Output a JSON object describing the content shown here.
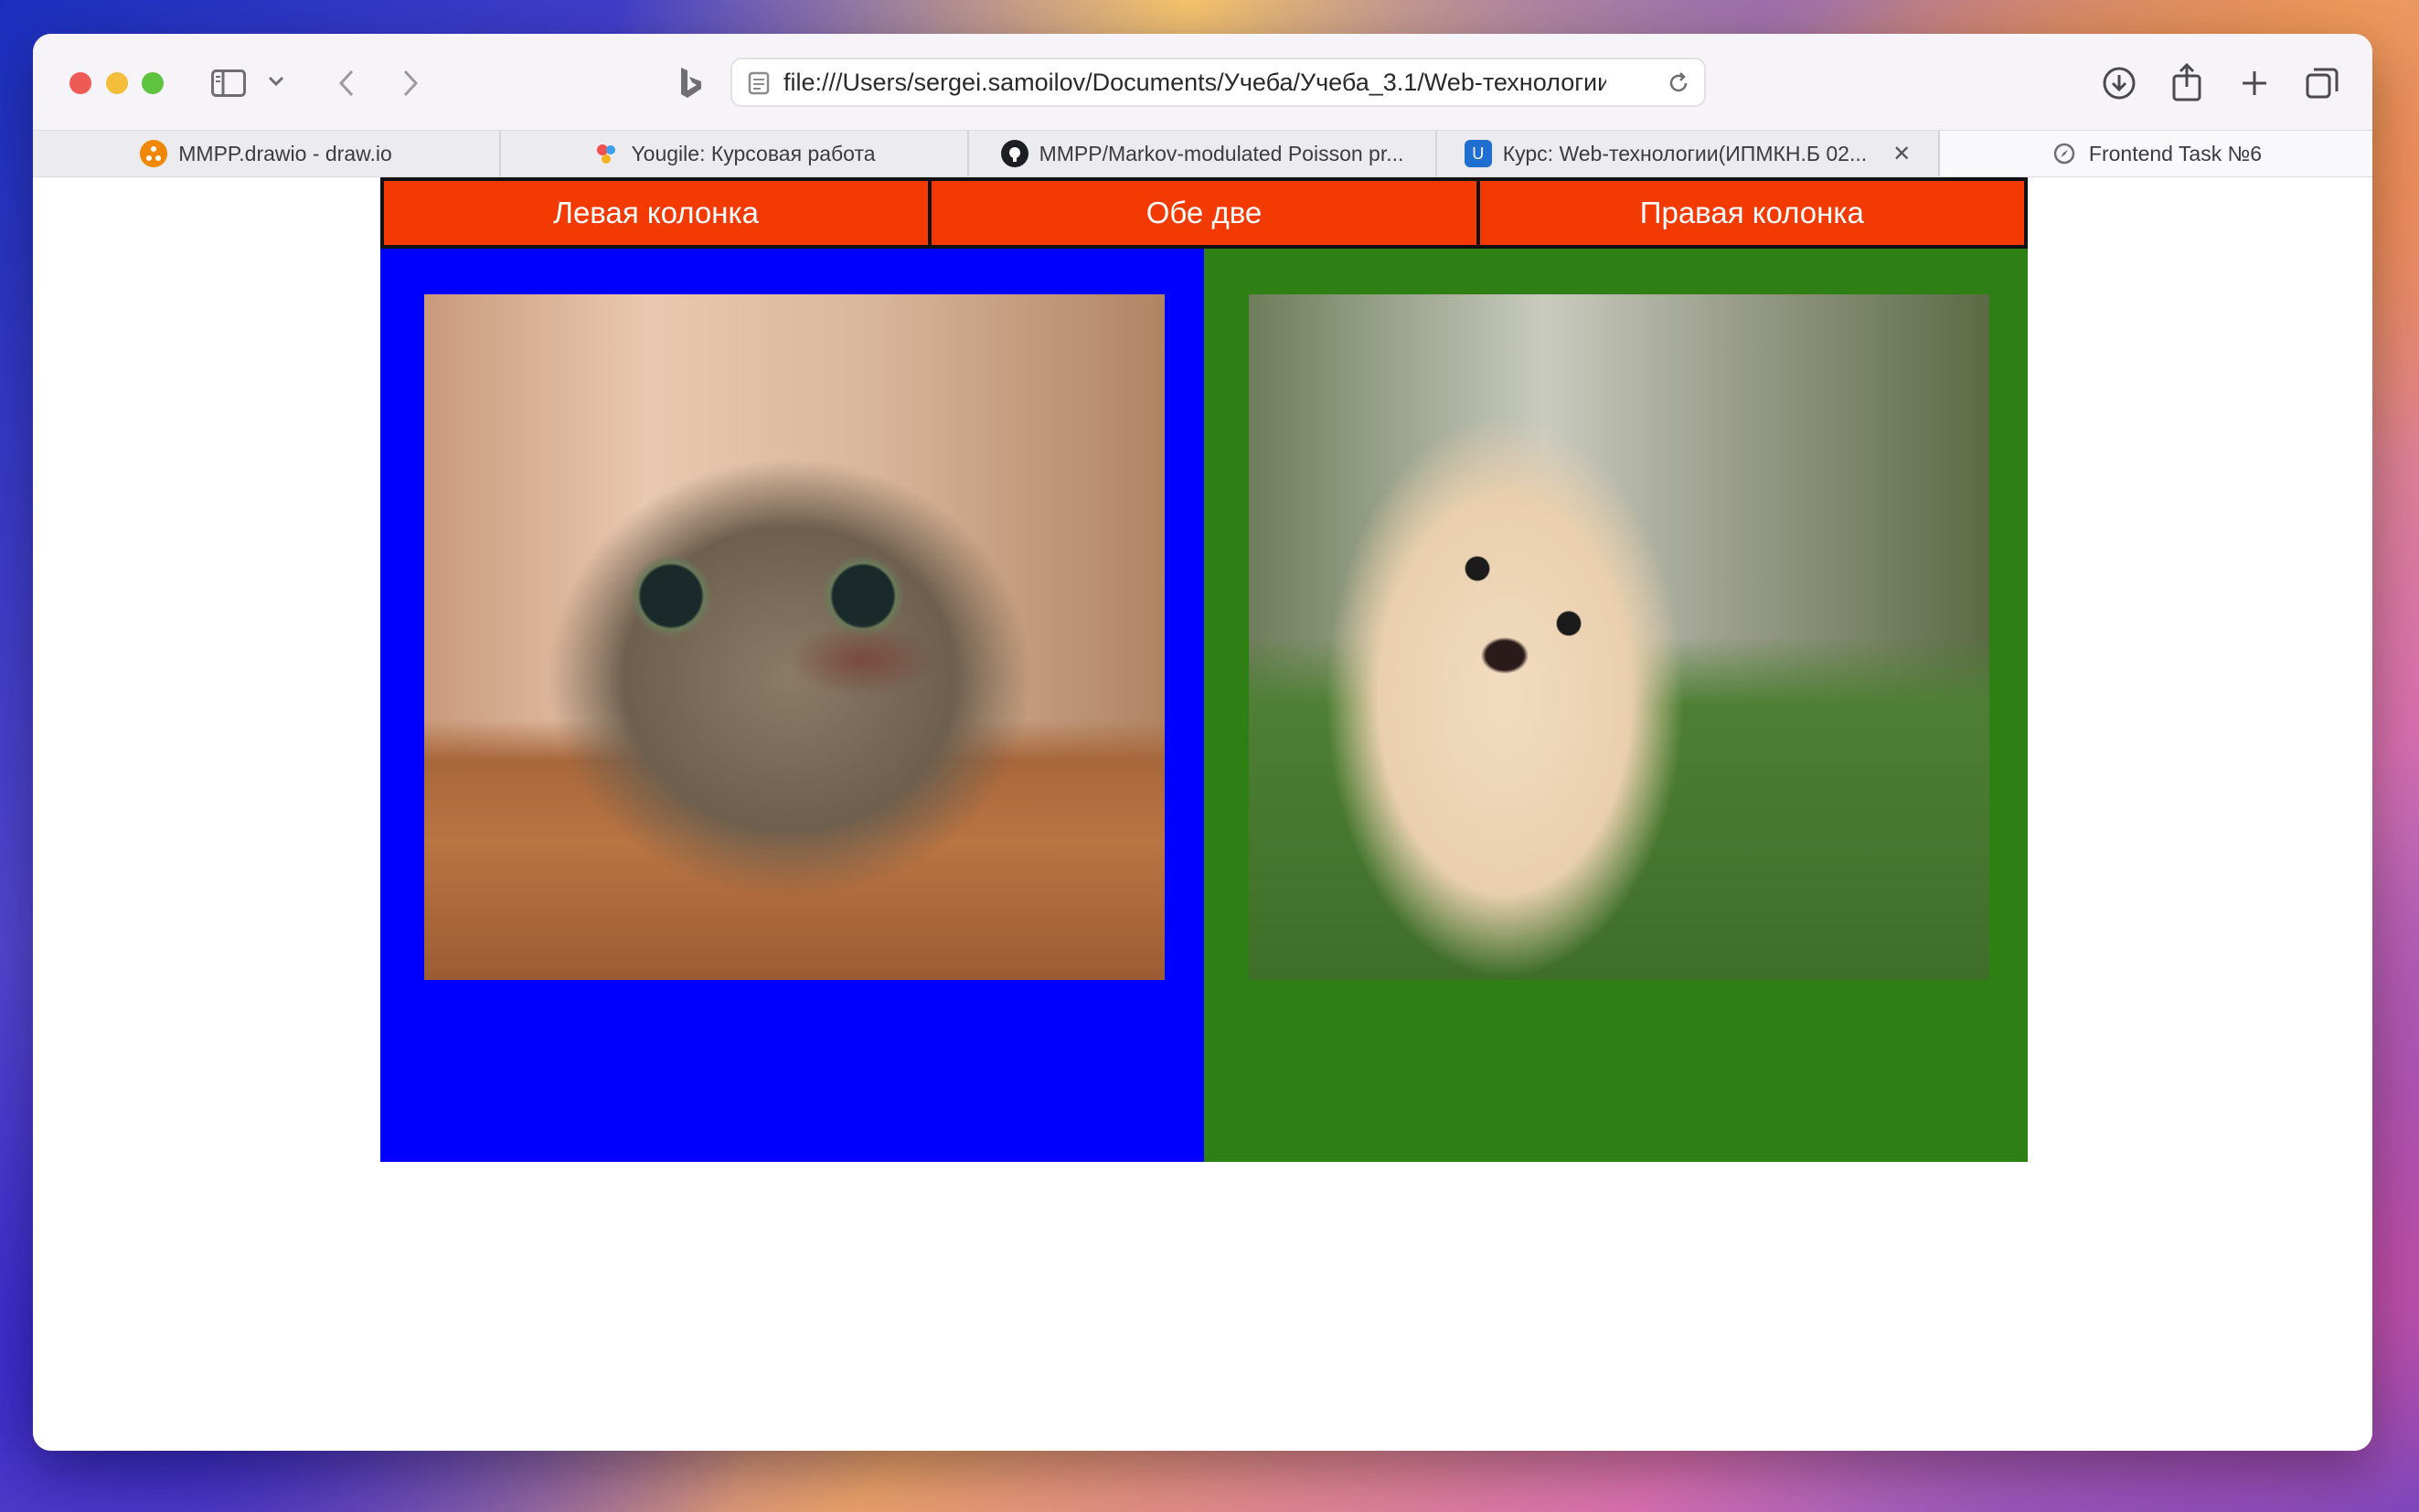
{
  "browser": {
    "address": "file:///Users/sergei.samoilov/Documents/Учеба/Учеба_3.1/Web-технологии",
    "tabs": [
      {
        "label": "MMPP.drawio - draw.io",
        "icon": "drawio-icon",
        "color": "#f08705"
      },
      {
        "label": "Yougile: Курсовая работа",
        "icon": "yougile-icon",
        "color": "#f0504f"
      },
      {
        "label": "MMPP/Markov-modulated Poisson pr...",
        "icon": "github-icon",
        "color": "#1b1f23"
      },
      {
        "label": "Курс: Web-технологии(ИПМКН.Б 02...",
        "icon": "university-icon",
        "color": "#1f6fd1"
      },
      {
        "label": "Frontend Task №6",
        "icon": "compass-icon",
        "color": "#6e6e73",
        "active": true
      }
    ]
  },
  "page": {
    "nav": {
      "left": "Левая колонка",
      "both": "Обе две",
      "right": "Правая колонка"
    },
    "colors": {
      "nav_bg": "#f43a03",
      "left_column": "#0000ff",
      "right_column": "#2e7f14"
    },
    "images": [
      "cat-photo",
      "dog-photo"
    ]
  }
}
